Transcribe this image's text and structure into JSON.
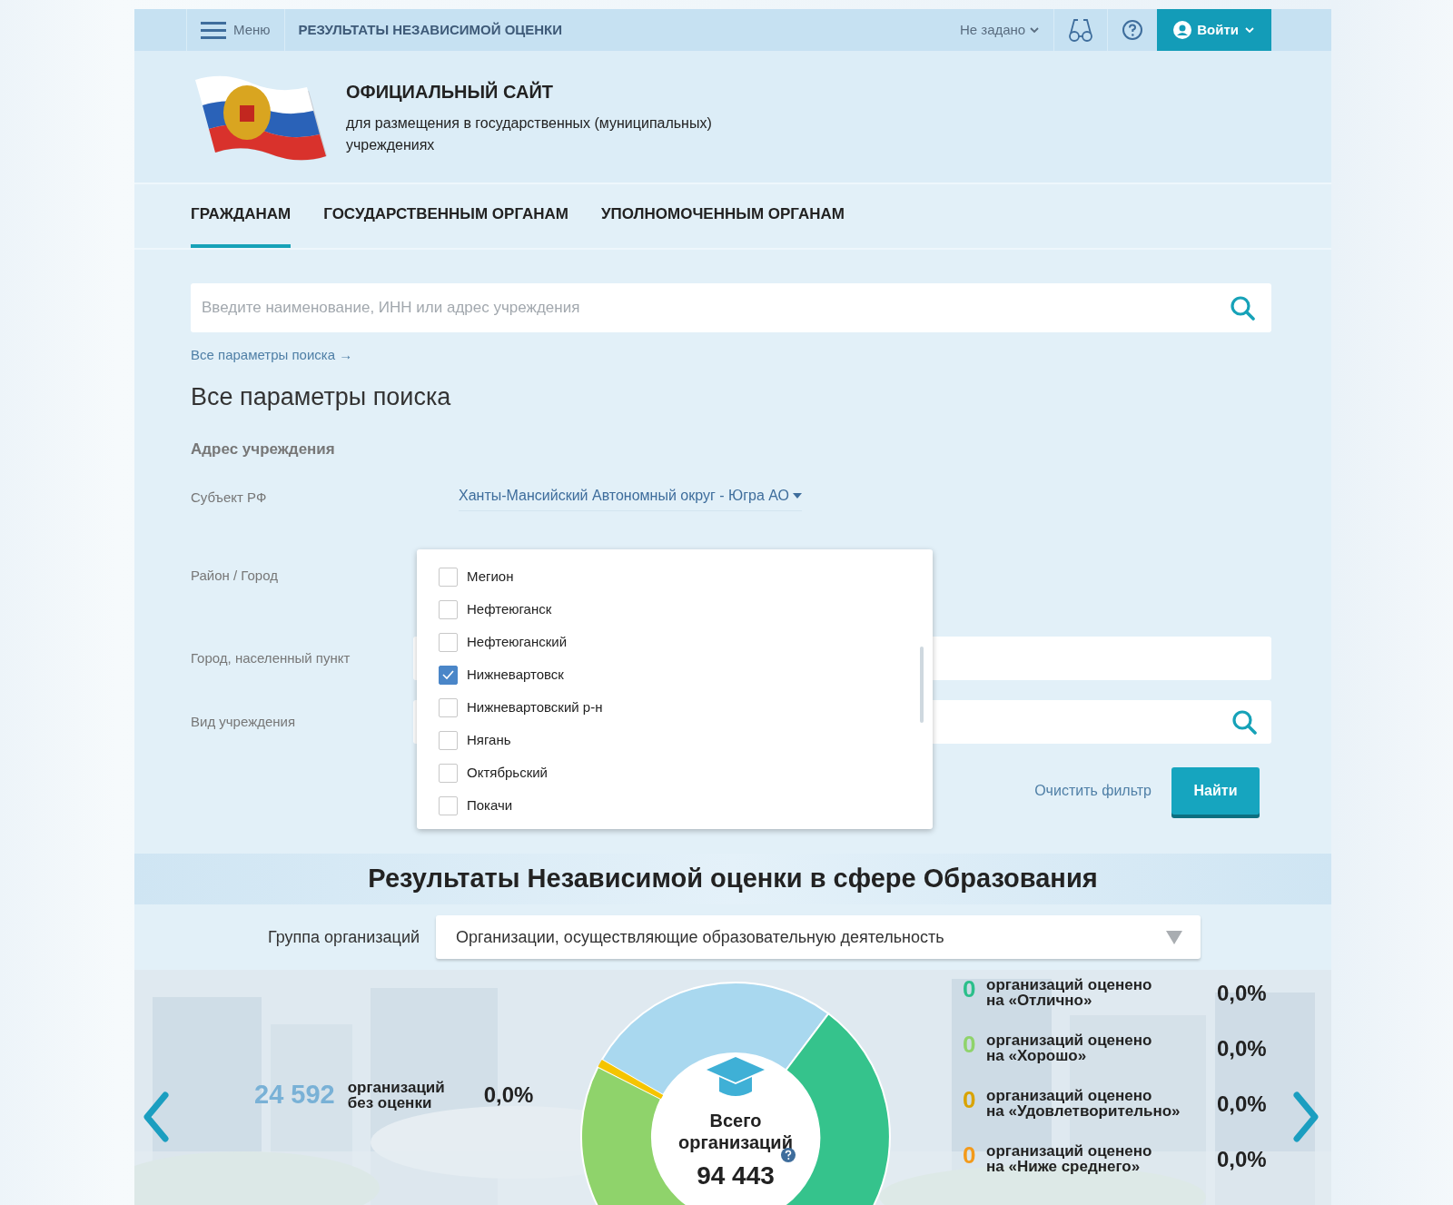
{
  "top_bar": {
    "menu_label": "Меню",
    "title": "РЕЗУЛЬТАТЫ НЕЗАВИСИМОЙ ОЦЕНКИ",
    "region": "Не задано",
    "login": "Войти"
  },
  "header": {
    "title": "ОФИЦИАЛЬНЫЙ САЙТ",
    "subtitle": "для размещения в государственных (муниципальных) учреждениях"
  },
  "nav_tabs": [
    {
      "label": "ГРАЖДАНАМ",
      "selected": true
    },
    {
      "label": "ГОСУДАРСТВЕННЫМ ОРГАНАМ",
      "selected": false
    },
    {
      "label": "УПОЛНОМОЧЕННЫМ ОРГАНАМ",
      "selected": false
    }
  ],
  "search": {
    "placeholder": "Введите наименование, ИНН или адрес учреждения"
  },
  "all_params_link": "Все параметры поиска →",
  "filters": {
    "title": "Все параметры поиска",
    "section": "Адрес учреждения",
    "fields": [
      {
        "kind": "select-link",
        "label": "Субъект РФ",
        "value": "Ханты-Мансийский Автономный округ - Югра АО"
      },
      {
        "kind": "multiselect",
        "label": "Район / Город"
      },
      {
        "kind": "input",
        "label": "Город, населенный пункт"
      },
      {
        "kind": "search",
        "label": "Вид учреждения"
      }
    ]
  },
  "district_dropdown": {
    "items": [
      {
        "label": "Мегион",
        "checked": false
      },
      {
        "label": "Нефтеюганск",
        "checked": false
      },
      {
        "label": "Нефтеюганский",
        "checked": false
      },
      {
        "label": "Нижневартовск",
        "checked": true
      },
      {
        "label": "Нижневартовский р-н",
        "checked": false
      },
      {
        "label": "Нягань",
        "checked": false
      },
      {
        "label": "Октябрьский",
        "checked": false
      },
      {
        "label": "Покачи",
        "checked": false
      }
    ]
  },
  "actions": {
    "clear": "Очистить фильтр",
    "submit": "Найти"
  },
  "results": {
    "title": "Результаты Независимой оценки в сфере Образования",
    "group_label": "Группа организаций",
    "group_value": "Организации, осуществляющие образовательную деятельность",
    "unrated": {
      "count": "24 592",
      "label": "организаций без оценки",
      "percent": "0,0%"
    },
    "total": {
      "label": "Всего организаций",
      "count": "94 443"
    },
    "ratings": [
      {
        "count": "0",
        "line1": "организаций оценено",
        "line2": "на «Отлично»",
        "percent": "0,0%",
        "color": "#2bbf8a"
      },
      {
        "count": "0",
        "line1": "организаций оценено",
        "line2": "на «Хорошо»",
        "percent": "0,0%",
        "color": "#8fd36b"
      },
      {
        "count": "0",
        "line1": "организаций оценено",
        "line2": "на «Удовлетворительно»",
        "percent": "0,0%",
        "color": "#d9a300"
      },
      {
        "count": "0",
        "line1": "организаций оценено",
        "line2": "на «Ниже среднего»",
        "percent": "0,0%",
        "color": "#f39a1b"
      }
    ]
  }
}
